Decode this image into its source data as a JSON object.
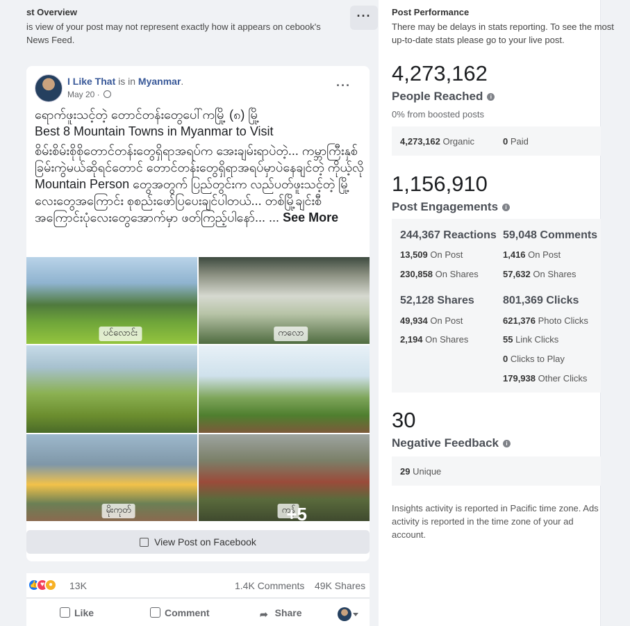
{
  "post_overview": {
    "title": "st Overview",
    "description": "is view of your post may not represent exactly how it appears on cebook's News Feed.",
    "more_label": "···"
  },
  "post": {
    "author": "I Like That",
    "is_in": "is in",
    "location": "Myanmar",
    "date": "May 20 ·",
    "more_label": "···",
    "text_line1": "ရောက်ဖူးသင့်တဲ့ တောင်တန်းတွေပေါ်ကမြို့ (၈) မြို့",
    "text_line2": "Best 8 Mountain Towns in Myanmar to Visit",
    "text_body": "စိမ်းစိမ်းစိုစိုတောင်တန်းတွေရှိရာအရပ်က အေးချမ်းရာပဲတဲ့... ကမ္ဘာကြီးနှစ်ခြမ်းကွဲမယ်ဆိုရင်တောင် တောင်တန်းတွေရှိရာအရပ်မှာပဲနေချင်တဲ့ ကိုယ့်လို Mountain Person တွေအတွက် ပြည်တွင်းက လည်ပတ်ဖူးသင့်တဲ့ မြို့လေးတွေအကြောင်း စုစည်းဖော်ပြပေးချင်ပါတယ်... တစ်မြို့ချင်းစီအကြောင်းပုံလေးတွေအောက်မှာ ဖတ်ကြည့်ပါနော်... ...",
    "see_more": "See More",
    "photo_tags": [
      "ပင်လောင်း",
      "ကလော",
      "",
      "",
      "မိုးကုတ်",
      "ကန်"
    ],
    "more_photos": "+5",
    "view_post_label": "View Post on Facebook"
  },
  "social": {
    "reaction_count": "13K",
    "comments": "1.4K Comments",
    "shares": "49K Shares",
    "like": "Like",
    "comment": "Comment",
    "share": "Share"
  },
  "performance": {
    "title": "Post Performance",
    "description": "There may be delays in stats reporting. To see the most up-to-date stats please go to your live post.",
    "reached": "4,273,162",
    "reached_label": "People Reached",
    "boosted": "0% from boosted posts",
    "organic_value": "4,273,162",
    "organic_label": "Organic",
    "paid_value": "0",
    "paid_label": "Paid",
    "engagements": "1,156,910",
    "engagements_label": "Post Engagements",
    "reactions_head": "244,367 Reactions",
    "reactions_on_post": "13,509",
    "reactions_on_shares": "230,858",
    "comments_head": "59,048 Comments",
    "comments_on_post": "1,416",
    "comments_on_shares": "57,632",
    "shares_head": "52,128 Shares",
    "shares_on_post": "49,934",
    "shares_on_shares": "2,194",
    "clicks_head": "801,369 Clicks",
    "photo_clicks": "621,376",
    "link_clicks": "55",
    "clicks_to_play": "0",
    "other_clicks": "179,938",
    "on_post_label": "On Post",
    "on_shares_label": "On Shares",
    "photo_clicks_label": "Photo Clicks",
    "link_clicks_label": "Link Clicks",
    "clicks_to_play_label": "Clicks to Play",
    "other_clicks_label": "Other Clicks",
    "negative": "30",
    "negative_label": "Negative Feedback",
    "unique_value": "29",
    "unique_label": "Unique",
    "footer": "Insights activity is reported in Pacific time zone. Ads activity is reported in the time zone of your ad account."
  }
}
